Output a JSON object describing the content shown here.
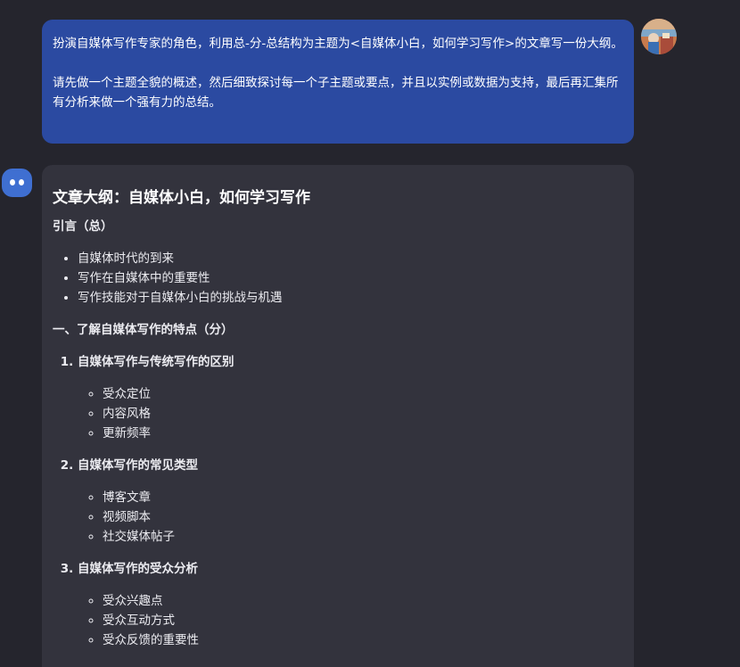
{
  "user_message": {
    "paragraph_1": "扮演自媒体写作专家的角色，利用总-分-总结构为主题为<自媒体小白，如何学习写作>的文章写一份大纲。",
    "paragraph_2": "请先做一个主题全貌的概述，然后细致探讨每一个子主题或要点，并且以实例或数据为支持，最后再汇集所有分析来做一个强有力的总结。",
    "bubble_color": "#2b4aa1"
  },
  "assistant_message": {
    "title": "文章大纲：自媒体小白，如何学习写作",
    "intro_heading": "引言（总）",
    "intro_items": [
      "自媒体时代的到来",
      "写作在自媒体中的重要性",
      "写作技能对于自媒体小白的挑战与机遇"
    ],
    "section_1": {
      "heading": "一、了解自媒体写作的特点（分）",
      "subsections": [
        {
          "title": "自媒体写作与传统写作的区别",
          "items": [
            "受众定位",
            "内容风格",
            "更新频率"
          ]
        },
        {
          "title": "自媒体写作的常见类型",
          "items": [
            "博客文章",
            "视频脚本",
            "社交媒体帖子"
          ]
        },
        {
          "title": "自媒体写作的受众分析",
          "items": [
            "受众兴趣点",
            "受众互动方式",
            "受众反馈的重要性"
          ]
        }
      ]
    },
    "bubble_color": "#33333d"
  },
  "icons": {
    "user_avatar": "user-avatar-photo",
    "bot_avatar": "bot-avatar-icon"
  }
}
